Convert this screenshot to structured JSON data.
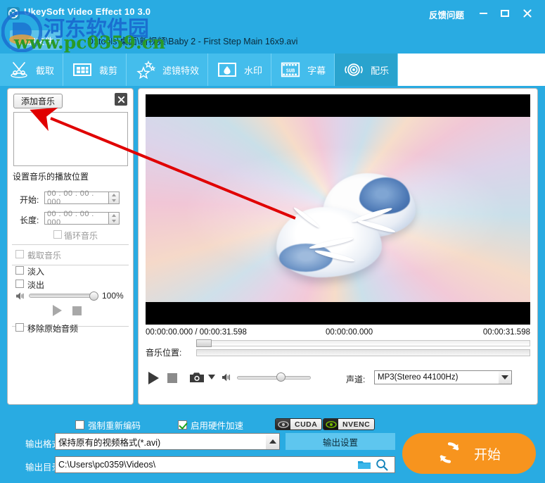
{
  "window": {
    "title": "UkeySoft Video Effect 10 3.0",
    "feedback": "反馈问题",
    "minimize": "—",
    "maximize": "□",
    "close": "✕"
  },
  "filerow": {
    "add_file": "添加文件",
    "path": "D:\\tools\\桌面\\新视频\\Baby 2 - First Step Main 16x9.avi"
  },
  "tabs": [
    {
      "label": "截取",
      "icon": "scissors-icon",
      "active": false
    },
    {
      "label": "裁剪",
      "icon": "crop-grid-icon",
      "active": false
    },
    {
      "label": "滤镜特效",
      "icon": "stars-icon",
      "active": false
    },
    {
      "label": "水印",
      "icon": "droplet-icon",
      "active": false
    },
    {
      "label": "字幕",
      "icon": "subtitle-film-icon",
      "active": false
    },
    {
      "label": "配乐",
      "icon": "audio-ring-icon",
      "active": true
    }
  ],
  "left_panel": {
    "add_music": "添加音乐",
    "close": "✕",
    "music_list_items": [],
    "section_title": "设置音乐的播放位置",
    "start_label": "开始:",
    "start_value": "00 : 00 : 00 . 000",
    "length_label": "长度:",
    "length_value": "00 : 00 : 00 . 000",
    "loop_music": "循环音乐",
    "capture_music": "截取音乐",
    "fade_in": "淡入",
    "fade_out": "淡出",
    "volume_percent": "100%",
    "remove_original_audio": "移除原始音频"
  },
  "preview": {
    "current_over_total": "00:00:00.000 / 00:00:31.598",
    "mid_time": "00:00:00.000",
    "end_time": "00:00:31.598",
    "music_position_label": "音乐位置:",
    "channel_label": "声道:",
    "channel_value": "MP3(Stereo 44100Hz)",
    "channel_options": [
      "MP3(Stereo 44100Hz)"
    ]
  },
  "bottom": {
    "force_reencode": "强制重新编码",
    "force_reencode_checked": false,
    "enable_hw_accel": "启用硬件加速",
    "enable_hw_accel_checked": true,
    "cuda_badge": "CUDA",
    "nvenc_badge": "NVENC",
    "output_format_label": "输出格式:",
    "output_format_value": "保持原有的视频格式(*.avi)",
    "output_settings": "输出设置",
    "output_dir_label": "输出目录:",
    "output_dir_value": "C:\\Users\\pc0359\\Videos\\",
    "start_button": "开始"
  },
  "watermark": {
    "site_cn": "河东软件园",
    "site_url": "www.pc0359.cn"
  },
  "colors": {
    "window_blue": "#29ABE2",
    "tabbar_blue": "#44bdec",
    "tab_active": "#29a3ce",
    "accent_orange": "#F7941E",
    "nvidia_green": "#76b900"
  }
}
